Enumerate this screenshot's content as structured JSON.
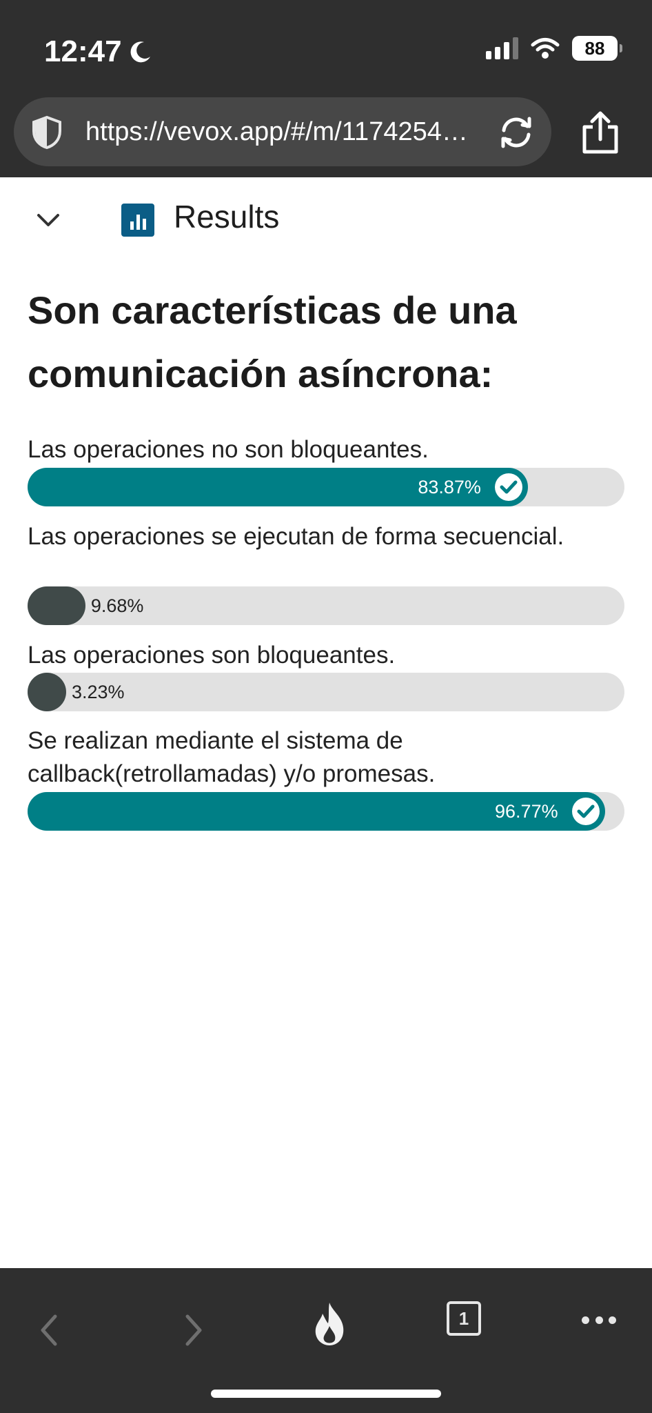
{
  "status_bar": {
    "time": "12:47",
    "battery": "88",
    "icons": [
      "moon-icon",
      "signal-icon",
      "wifi-icon",
      "battery-icon"
    ]
  },
  "browser": {
    "url": "https://vevox.app/#/m/1174254…",
    "icons": [
      "shield-icon",
      "reload-icon",
      "share-icon"
    ]
  },
  "results": {
    "title": "Results",
    "icons": [
      "chevron-down-icon",
      "bar-chart-icon"
    ]
  },
  "question": "Son características de una comunicación asíncrona:",
  "options": [
    {
      "label": "Las operaciones no son bloqueantes.",
      "percent": 83.87,
      "percent_label": "83.87%",
      "correct": true
    },
    {
      "label": "Las operaciones se ejecutan de forma secuencial.",
      "percent": 9.68,
      "percent_label": "9.68%",
      "correct": false
    },
    {
      "label": "Las operaciones son bloqueantes.",
      "percent": 3.23,
      "percent_label": "3.23%",
      "correct": false
    },
    {
      "label": "Se realizan mediante el sistema de callback(retrollamadas) y/o promesas.",
      "percent": 96.77,
      "percent_label": "96.77%",
      "correct": true
    }
  ],
  "toolbar": {
    "tab_count": "1",
    "icons": [
      "back-icon",
      "forward-icon",
      "flame-icon",
      "tabs-icon",
      "more-icon"
    ]
  },
  "colors": {
    "correct": "#007f86",
    "incorrect": "#404a49",
    "track": "#e1e1e1",
    "chrome": "#2f2f2f",
    "accent": "#0b5d86"
  }
}
